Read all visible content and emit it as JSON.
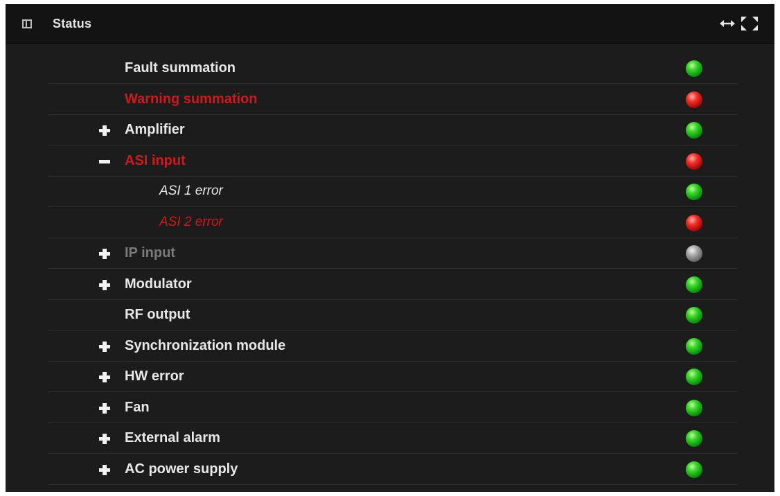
{
  "window": {
    "title": "Status",
    "icons": {
      "panel": "panel-icon",
      "resize": "resize-horizontal-icon",
      "fullscreen": "fullscreen-icon"
    }
  },
  "colors": {
    "ok": "#1fbf1a",
    "alarm": "#d0181b",
    "inactive": "#8a8a8a",
    "text": "#e8e8e8",
    "background": "#1c1c1c"
  },
  "status_rows": [
    {
      "label": "Fault summation",
      "level": 0,
      "toggle": "none",
      "label_state": "normal",
      "led": "green"
    },
    {
      "label": "Warning summation",
      "level": 0,
      "toggle": "none",
      "label_state": "warn",
      "led": "red"
    },
    {
      "label": "Amplifier",
      "level": 0,
      "toggle": "plus",
      "label_state": "normal",
      "led": "green"
    },
    {
      "label": "ASI input",
      "level": 0,
      "toggle": "minus",
      "label_state": "warn",
      "led": "red"
    },
    {
      "label": "ASI 1 error",
      "level": 1,
      "toggle": "none",
      "label_state": "normal",
      "led": "green"
    },
    {
      "label": "ASI 2 error",
      "level": 1,
      "toggle": "none",
      "label_state": "warn",
      "led": "red"
    },
    {
      "label": "IP input",
      "level": 0,
      "toggle": "plus",
      "label_state": "disabled",
      "led": "gray"
    },
    {
      "label": "Modulator",
      "level": 0,
      "toggle": "plus",
      "label_state": "normal",
      "led": "green"
    },
    {
      "label": "RF output",
      "level": 0,
      "toggle": "none",
      "label_state": "normal",
      "led": "green"
    },
    {
      "label": "Synchronization module",
      "level": 0,
      "toggle": "plus",
      "label_state": "normal",
      "led": "green"
    },
    {
      "label": "HW error",
      "level": 0,
      "toggle": "plus",
      "label_state": "normal",
      "led": "green"
    },
    {
      "label": "Fan",
      "level": 0,
      "toggle": "plus",
      "label_state": "normal",
      "led": "green"
    },
    {
      "label": "External alarm",
      "level": 0,
      "toggle": "plus",
      "label_state": "normal",
      "led": "green"
    },
    {
      "label": "AC power supply",
      "level": 0,
      "toggle": "plus",
      "label_state": "normal",
      "led": "green"
    }
  ]
}
